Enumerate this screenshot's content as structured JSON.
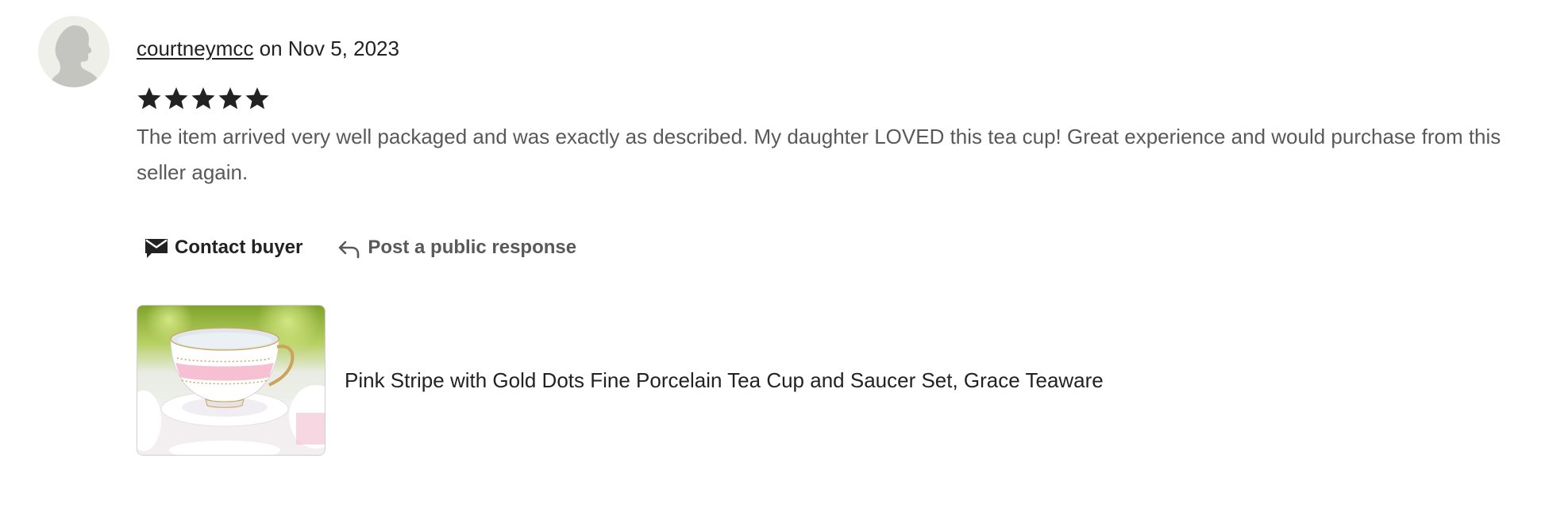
{
  "review": {
    "username": "courtneymcc",
    "date_text": " on Nov 5, 2023",
    "rating": 5,
    "rating_max": 5,
    "text": "The item arrived very well packaged and was exactly as described. My daughter LOVED this tea cup! Great experience and would purchase from this seller again."
  },
  "actions": {
    "contact_label": "Contact buyer",
    "contact_icon": "envelope-icon",
    "respond_label": "Post a public response",
    "respond_icon": "reply-arrow-icon"
  },
  "product": {
    "title": "Pink Stripe with Gold Dots Fine Porcelain Tea Cup and Saucer Set, Grace Teaware"
  },
  "colors": {
    "primary_text": "#222222",
    "secondary_text": "#595959",
    "avatar_bg": "#efefea",
    "avatar_silhouette": "#c4c4c0"
  }
}
